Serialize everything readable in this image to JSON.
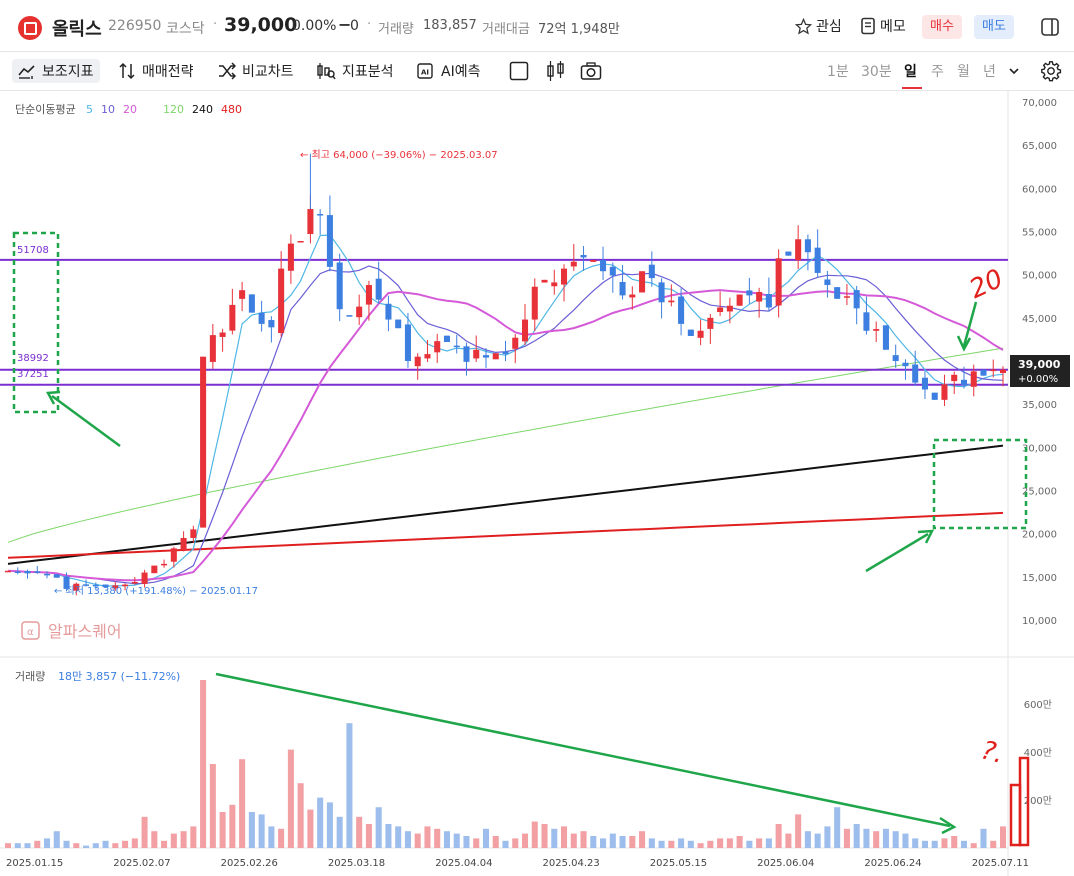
{
  "header": {
    "name": "올릭스",
    "code": "226950",
    "market": "코스닥",
    "price": "39,000",
    "change_pct": "0.00%",
    "change_abs": "0",
    "volume_label": "거래량",
    "volume_value": "183,857",
    "amount_label": "거래대금",
    "amount_value": "72억 1,948만",
    "watch_label": "관심",
    "memo_label": "메모",
    "buy_label": "매수",
    "sell_label": "매도"
  },
  "toolbar": {
    "items": [
      "보조지표",
      "매매전략",
      "비교차트",
      "지표분석",
      "AI예측"
    ],
    "periods": [
      "1분",
      "30분",
      "일",
      "주",
      "월",
      "년"
    ],
    "active_period": "일"
  },
  "ma_legend": {
    "title": "단순이동평균",
    "items": [
      {
        "label": "5",
        "color": "#4fb7e6"
      },
      {
        "label": "10",
        "color": "#6a5fd6"
      },
      {
        "label": "20",
        "color": "#d45ad8"
      },
      {
        "label": "120",
        "color": "#7ed66a"
      },
      {
        "label": "240",
        "color": "#111111"
      },
      {
        "label": "480",
        "color": "#e02020"
      }
    ]
  },
  "annotations": {
    "high": "← 최고 64,000 (−39.06%) − 2025.03.07",
    "low": "← 최저 13,380 (+191.48%) − 2025.01.17",
    "level1": "51708",
    "level2": "38992",
    "level3": "37251",
    "last_price": "39,000",
    "last_change": "+0.00%",
    "handwritten_20": "20",
    "handwritten_q": "?."
  },
  "watermark": "알파스퀘어",
  "volume_legend": {
    "title": "거래량",
    "value": "18만 3,857 (−11.72%)"
  },
  "colors": {
    "up": "#e8323a",
    "down": "#3c7fe0",
    "vol_up": "#f2a0a4",
    "vol_down": "#9dbdec",
    "level": "#7b2fd0",
    "arrow": "#1fa64a",
    "box": "#1fa64a"
  },
  "chart_data": [
    {
      "type": "candlestick",
      "ylim": [
        10000,
        70000
      ],
      "y_ticks": [
        "70,000",
        "65,000",
        "60,000",
        "55,000",
        "50,000",
        "45,000",
        "40,000",
        "35,000",
        "30,000",
        "25,000",
        "20,000",
        "15,000",
        "10,000"
      ],
      "x_ticks": [
        "2025.01.15",
        "2025.02.07",
        "2025.02.26",
        "2025.03.18",
        "2025.04.04",
        "2025.04.23",
        "2025.05.15",
        "2025.06.04",
        "2025.06.24",
        "2025.07.11"
      ],
      "horizontal_levels": [
        51708,
        38992,
        37251
      ],
      "close_series": [
        15700,
        15600,
        15400,
        15500,
        15300,
        14900,
        13600,
        14200,
        14000,
        13900,
        13800,
        14000,
        14100,
        14400,
        15500,
        16300,
        16500,
        18300,
        19500,
        20500,
        40500,
        43000,
        43300,
        46500,
        48200,
        45600,
        44300,
        43900,
        50700,
        53600,
        53900,
        57600,
        56900,
        50900,
        46000,
        45300,
        46300,
        48800,
        47100,
        44800,
        43800,
        40000,
        40500,
        40800,
        42300,
        42200,
        41700,
        39900,
        41300,
        40400,
        40900,
        40800,
        42700,
        44800,
        48600,
        49400,
        49100,
        50700,
        51500,
        52000,
        51700,
        50400,
        49900,
        47600,
        47700,
        50400,
        49600,
        46800,
        47000,
        44300,
        42900,
        43500,
        45000,
        46200,
        46400,
        47700,
        47600,
        48000,
        46200,
        51900,
        52200,
        54100,
        52600,
        50200,
        48800,
        47200,
        47500,
        46100,
        43500,
        43700,
        41300,
        40000,
        39400,
        37500,
        36700,
        35500,
        37300,
        38400,
        37200,
        38800,
        38300,
        39000,
        39000
      ],
      "ma_series": {
        "5": "computed",
        "10": "computed",
        "20": "computed"
      },
      "long_ma_endpoints": {
        "120": [
          19000,
          41500
        ],
        "240": [
          16500,
          30200
        ],
        "480": [
          17200,
          22400
        ]
      },
      "high_marker": {
        "value": 64000,
        "date": "2025.03.07"
      },
      "low_marker": {
        "value": 13380,
        "date": "2025.01.17"
      }
    },
    {
      "type": "bar",
      "name": "volume",
      "ylim": [
        0,
        7000000
      ],
      "y_ticks": [
        "600만",
        "400만",
        "200만"
      ],
      "values_million": [
        0.2,
        0.2,
        0.2,
        0.3,
        0.4,
        0.7,
        0.3,
        0.2,
        0.1,
        0.2,
        0.3,
        0.2,
        0.3,
        0.4,
        1.3,
        0.7,
        0.3,
        0.6,
        0.7,
        0.9,
        7.4,
        3.5,
        1.5,
        1.8,
        3.7,
        1.5,
        1.4,
        0.9,
        0.8,
        4.1,
        2.7,
        1.6,
        2.1,
        1.9,
        1.3,
        5.2,
        1.3,
        1.0,
        1.7,
        1.0,
        0.9,
        0.7,
        0.6,
        0.9,
        0.8,
        0.7,
        0.6,
        0.5,
        0.4,
        0.8,
        0.5,
        0.3,
        0.4,
        0.6,
        1.1,
        1.0,
        0.8,
        0.9,
        0.6,
        0.7,
        0.5,
        0.4,
        0.6,
        0.5,
        0.5,
        0.7,
        0.4,
        0.3,
        0.3,
        0.4,
        0.3,
        0.2,
        0.3,
        0.4,
        0.4,
        0.5,
        0.3,
        0.4,
        0.4,
        1.0,
        0.6,
        1.4,
        0.7,
        0.6,
        0.9,
        1.7,
        0.8,
        1.0,
        0.8,
        0.7,
        0.8,
        0.7,
        0.6,
        0.4,
        0.3,
        0.3,
        0.4,
        0.5,
        0.3,
        0.2,
        0.8,
        0.3,
        0.9
      ]
    }
  ]
}
